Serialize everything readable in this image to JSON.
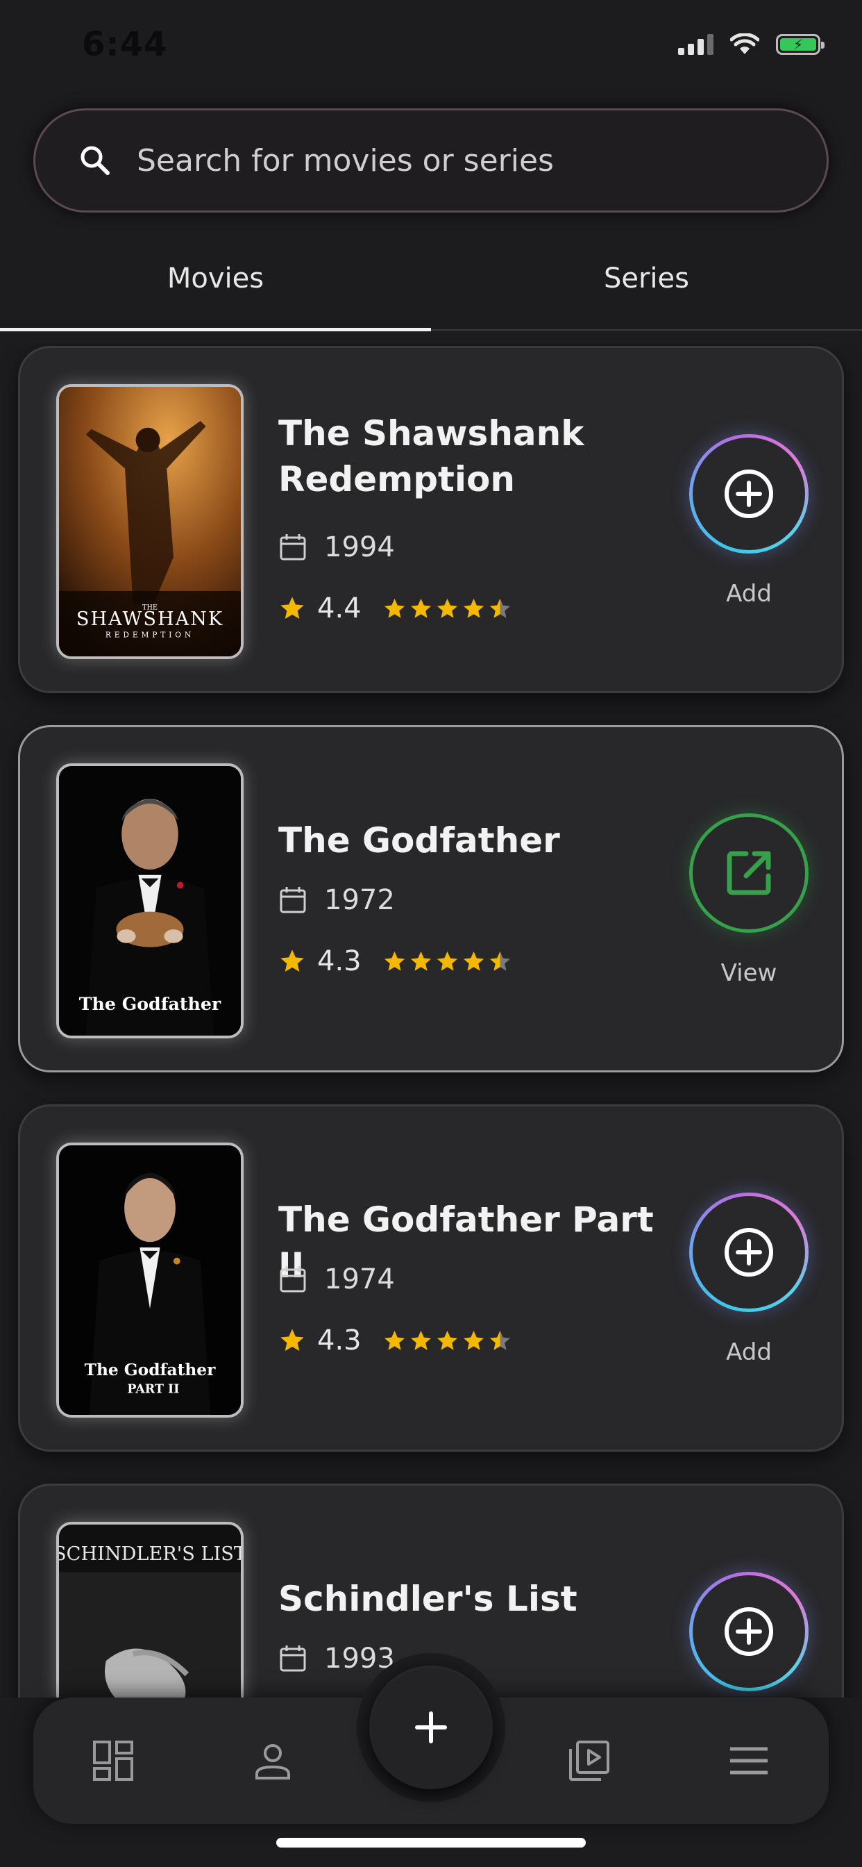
{
  "status_bar": {
    "time": "6:44"
  },
  "search": {
    "placeholder": "Search for movies or series"
  },
  "tabs": [
    {
      "label": "Movies",
      "active": true
    },
    {
      "label": "Series",
      "active": false
    }
  ],
  "movies": [
    {
      "title": "The Shawshank Redemption",
      "year": "1994",
      "rating": "4.4",
      "stars": 4.5,
      "action": "Add",
      "poster_text": "SHAWSHANK",
      "poster_subtext": "REDEMPTION",
      "poster_small": "THE"
    },
    {
      "title": "The Godfather",
      "year": "1972",
      "rating": "4.3",
      "stars": 4.5,
      "action": "View",
      "poster_text": "The Godfather"
    },
    {
      "title": "The Godfather Part II",
      "year": "1974",
      "rating": "4.3",
      "stars": 4.5,
      "action": "Add",
      "poster_text": "The Godfather",
      "poster_subtext": "PART II"
    },
    {
      "title": "Schindler's List",
      "year": "1993",
      "rating": "",
      "stars": 0,
      "action": "Add",
      "poster_text": "SCHINDLER'S LIST"
    }
  ],
  "bottom_nav": {
    "items": [
      "dashboard-icon",
      "profile-icon",
      "video-library-icon",
      "menu-icon"
    ],
    "fab": "plus-icon"
  },
  "colors": {
    "background": "#1c1c1e",
    "card": "#28282b",
    "star": "#f5b800",
    "view_green": "#36a04a",
    "add_gradient_start": "#3bc8e6",
    "add_gradient_end": "#e07ad8"
  }
}
